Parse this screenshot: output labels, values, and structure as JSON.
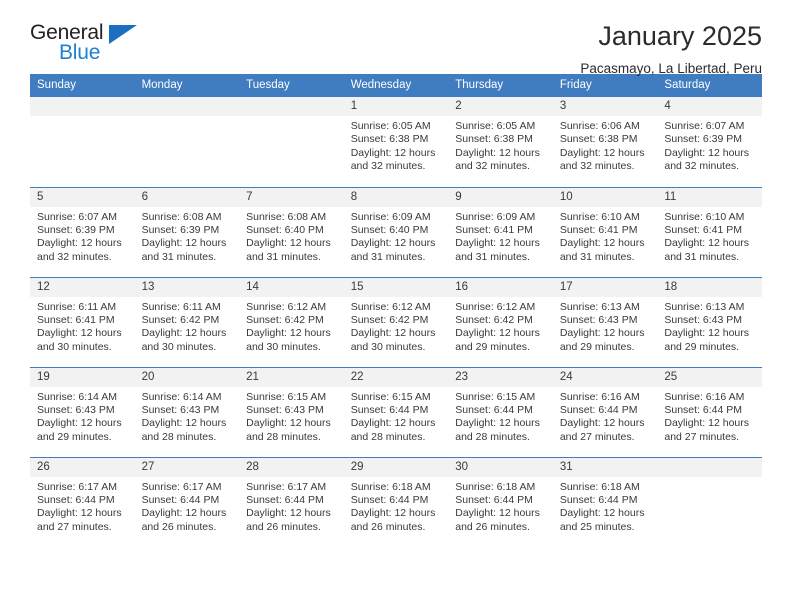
{
  "logo": {
    "word_top": "General",
    "word_bottom": "Blue",
    "triangle_icon": "triangle-icon",
    "accent_color": "#1b6fc0"
  },
  "header": {
    "title": "January 2025",
    "subtitle": "Pacasmayo, La Libertad, Peru",
    "header_band_color": "#3f7cc0",
    "daynum_strip_color": "#f2f2f2"
  },
  "weekdays": [
    "Sunday",
    "Monday",
    "Tuesday",
    "Wednesday",
    "Thursday",
    "Friday",
    "Saturday"
  ],
  "labels": {
    "sunrise": "Sunrise:",
    "sunset": "Sunset:",
    "daylight": "Daylight:"
  },
  "weeks": [
    [
      {
        "day": "",
        "blank": true
      },
      {
        "day": "",
        "blank": true
      },
      {
        "day": "",
        "blank": true
      },
      {
        "day": "1",
        "sunrise": "Sunrise: 6:05 AM",
        "sunset": "Sunset: 6:38 PM",
        "daylight1": "Daylight: 12 hours",
        "daylight2": "and 32 minutes."
      },
      {
        "day": "2",
        "sunrise": "Sunrise: 6:05 AM",
        "sunset": "Sunset: 6:38 PM",
        "daylight1": "Daylight: 12 hours",
        "daylight2": "and 32 minutes."
      },
      {
        "day": "3",
        "sunrise": "Sunrise: 6:06 AM",
        "sunset": "Sunset: 6:38 PM",
        "daylight1": "Daylight: 12 hours",
        "daylight2": "and 32 minutes."
      },
      {
        "day": "4",
        "sunrise": "Sunrise: 6:07 AM",
        "sunset": "Sunset: 6:39 PM",
        "daylight1": "Daylight: 12 hours",
        "daylight2": "and 32 minutes."
      }
    ],
    [
      {
        "day": "5",
        "sunrise": "Sunrise: 6:07 AM",
        "sunset": "Sunset: 6:39 PM",
        "daylight1": "Daylight: 12 hours",
        "daylight2": "and 32 minutes."
      },
      {
        "day": "6",
        "sunrise": "Sunrise: 6:08 AM",
        "sunset": "Sunset: 6:39 PM",
        "daylight1": "Daylight: 12 hours",
        "daylight2": "and 31 minutes."
      },
      {
        "day": "7",
        "sunrise": "Sunrise: 6:08 AM",
        "sunset": "Sunset: 6:40 PM",
        "daylight1": "Daylight: 12 hours",
        "daylight2": "and 31 minutes."
      },
      {
        "day": "8",
        "sunrise": "Sunrise: 6:09 AM",
        "sunset": "Sunset: 6:40 PM",
        "daylight1": "Daylight: 12 hours",
        "daylight2": "and 31 minutes."
      },
      {
        "day": "9",
        "sunrise": "Sunrise: 6:09 AM",
        "sunset": "Sunset: 6:41 PM",
        "daylight1": "Daylight: 12 hours",
        "daylight2": "and 31 minutes."
      },
      {
        "day": "10",
        "sunrise": "Sunrise: 6:10 AM",
        "sunset": "Sunset: 6:41 PM",
        "daylight1": "Daylight: 12 hours",
        "daylight2": "and 31 minutes."
      },
      {
        "day": "11",
        "sunrise": "Sunrise: 6:10 AM",
        "sunset": "Sunset: 6:41 PM",
        "daylight1": "Daylight: 12 hours",
        "daylight2": "and 31 minutes."
      }
    ],
    [
      {
        "day": "12",
        "sunrise": "Sunrise: 6:11 AM",
        "sunset": "Sunset: 6:41 PM",
        "daylight1": "Daylight: 12 hours",
        "daylight2": "and 30 minutes."
      },
      {
        "day": "13",
        "sunrise": "Sunrise: 6:11 AM",
        "sunset": "Sunset: 6:42 PM",
        "daylight1": "Daylight: 12 hours",
        "daylight2": "and 30 minutes."
      },
      {
        "day": "14",
        "sunrise": "Sunrise: 6:12 AM",
        "sunset": "Sunset: 6:42 PM",
        "daylight1": "Daylight: 12 hours",
        "daylight2": "and 30 minutes."
      },
      {
        "day": "15",
        "sunrise": "Sunrise: 6:12 AM",
        "sunset": "Sunset: 6:42 PM",
        "daylight1": "Daylight: 12 hours",
        "daylight2": "and 30 minutes."
      },
      {
        "day": "16",
        "sunrise": "Sunrise: 6:12 AM",
        "sunset": "Sunset: 6:42 PM",
        "daylight1": "Daylight: 12 hours",
        "daylight2": "and 29 minutes."
      },
      {
        "day": "17",
        "sunrise": "Sunrise: 6:13 AM",
        "sunset": "Sunset: 6:43 PM",
        "daylight1": "Daylight: 12 hours",
        "daylight2": "and 29 minutes."
      },
      {
        "day": "18",
        "sunrise": "Sunrise: 6:13 AM",
        "sunset": "Sunset: 6:43 PM",
        "daylight1": "Daylight: 12 hours",
        "daylight2": "and 29 minutes."
      }
    ],
    [
      {
        "day": "19",
        "sunrise": "Sunrise: 6:14 AM",
        "sunset": "Sunset: 6:43 PM",
        "daylight1": "Daylight: 12 hours",
        "daylight2": "and 29 minutes."
      },
      {
        "day": "20",
        "sunrise": "Sunrise: 6:14 AM",
        "sunset": "Sunset: 6:43 PM",
        "daylight1": "Daylight: 12 hours",
        "daylight2": "and 28 minutes."
      },
      {
        "day": "21",
        "sunrise": "Sunrise: 6:15 AM",
        "sunset": "Sunset: 6:43 PM",
        "daylight1": "Daylight: 12 hours",
        "daylight2": "and 28 minutes."
      },
      {
        "day": "22",
        "sunrise": "Sunrise: 6:15 AM",
        "sunset": "Sunset: 6:44 PM",
        "daylight1": "Daylight: 12 hours",
        "daylight2": "and 28 minutes."
      },
      {
        "day": "23",
        "sunrise": "Sunrise: 6:15 AM",
        "sunset": "Sunset: 6:44 PM",
        "daylight1": "Daylight: 12 hours",
        "daylight2": "and 28 minutes."
      },
      {
        "day": "24",
        "sunrise": "Sunrise: 6:16 AM",
        "sunset": "Sunset: 6:44 PM",
        "daylight1": "Daylight: 12 hours",
        "daylight2": "and 27 minutes."
      },
      {
        "day": "25",
        "sunrise": "Sunrise: 6:16 AM",
        "sunset": "Sunset: 6:44 PM",
        "daylight1": "Daylight: 12 hours",
        "daylight2": "and 27 minutes."
      }
    ],
    [
      {
        "day": "26",
        "sunrise": "Sunrise: 6:17 AM",
        "sunset": "Sunset: 6:44 PM",
        "daylight1": "Daylight: 12 hours",
        "daylight2": "and 27 minutes."
      },
      {
        "day": "27",
        "sunrise": "Sunrise: 6:17 AM",
        "sunset": "Sunset: 6:44 PM",
        "daylight1": "Daylight: 12 hours",
        "daylight2": "and 26 minutes."
      },
      {
        "day": "28",
        "sunrise": "Sunrise: 6:17 AM",
        "sunset": "Sunset: 6:44 PM",
        "daylight1": "Daylight: 12 hours",
        "daylight2": "and 26 minutes."
      },
      {
        "day": "29",
        "sunrise": "Sunrise: 6:18 AM",
        "sunset": "Sunset: 6:44 PM",
        "daylight1": "Daylight: 12 hours",
        "daylight2": "and 26 minutes."
      },
      {
        "day": "30",
        "sunrise": "Sunrise: 6:18 AM",
        "sunset": "Sunset: 6:44 PM",
        "daylight1": "Daylight: 12 hours",
        "daylight2": "and 26 minutes."
      },
      {
        "day": "31",
        "sunrise": "Sunrise: 6:18 AM",
        "sunset": "Sunset: 6:44 PM",
        "daylight1": "Daylight: 12 hours",
        "daylight2": "and 25 minutes."
      },
      {
        "day": "",
        "blank": true
      }
    ]
  ]
}
